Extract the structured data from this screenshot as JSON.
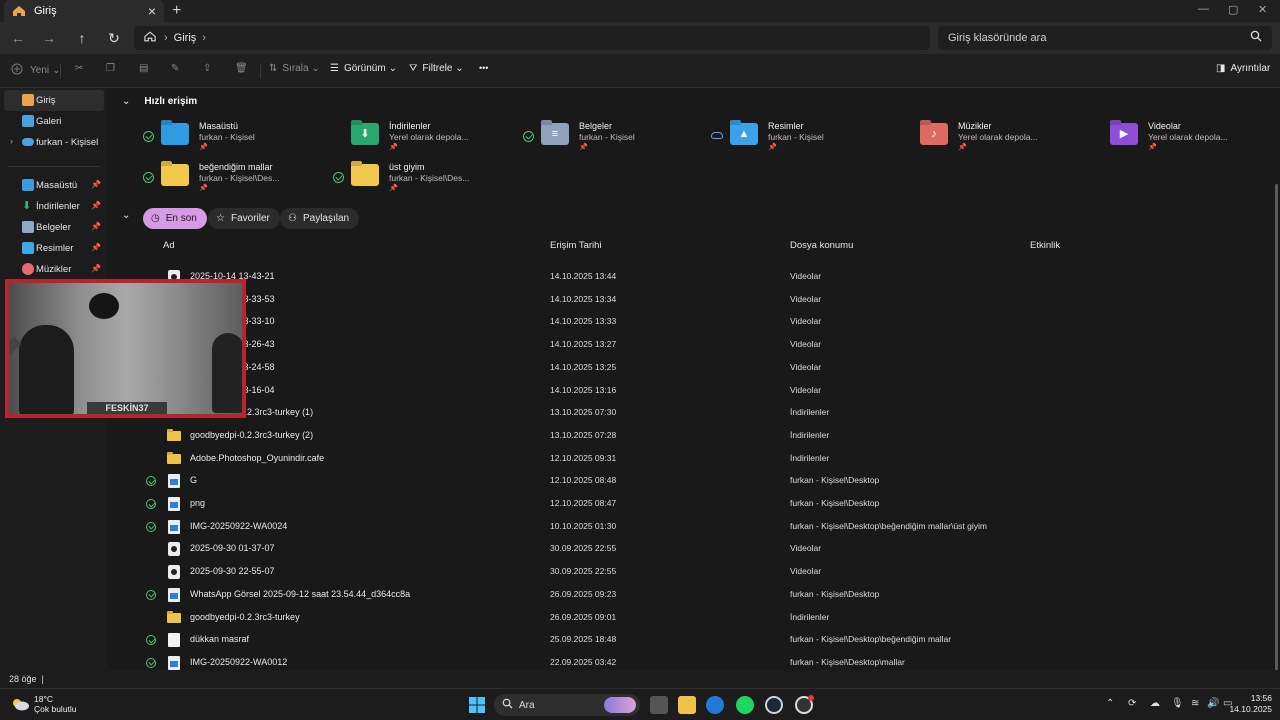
{
  "window": {
    "tab_label": "Giriş",
    "tab_close": "×",
    "new_tab": "+",
    "win_minimize": "—",
    "win_restore": "▢",
    "win_close": "✕"
  },
  "address": {
    "home_sep": "›",
    "crumb": "Giriş",
    "crumb_sep": "›",
    "search_placeholder": "Giriş klasöründe ara"
  },
  "commands": {
    "new": "Yeni",
    "sort": "Sırala",
    "view": "Görünüm",
    "filter": "Filtrele",
    "more": "•••",
    "details": "Ayrıntılar"
  },
  "sidebar": {
    "items": [
      {
        "label": "Giriş",
        "icon": "home-icon",
        "color": "#e8a54b"
      },
      {
        "label": "Galeri",
        "icon": "gallery-icon",
        "color": "#4aa3df"
      },
      {
        "label": "furkan - Kişisel",
        "icon": "cloud-icon",
        "color": "#4aa3df"
      },
      {
        "label": "Masaüstü",
        "icon": "desktop-icon",
        "color": "#3b9ae1"
      },
      {
        "label": "İndirilenler",
        "icon": "download-icon",
        "color": "#36b37e"
      },
      {
        "label": "Belgeler",
        "icon": "documents-icon",
        "color": "#8ea6c7"
      },
      {
        "label": "Resimler",
        "icon": "pictures-icon",
        "color": "#3fa8e6"
      },
      {
        "label": "Müzikler",
        "icon": "music-icon",
        "color": "#e56b6f"
      }
    ]
  },
  "quick_access": {
    "title": "Hızlı erişim",
    "items": [
      {
        "name": "Masaüstü",
        "sub": "furkan - Kişisel",
        "status": "check",
        "color": "#2f9be0",
        "icon": "desktop-folder-icon",
        "glyph": ""
      },
      {
        "name": "İndirilenler",
        "sub": "Yerel olarak depola...",
        "status": "",
        "color": "#27a86c",
        "icon": "downloads-folder-icon",
        "glyph": "⬇"
      },
      {
        "name": "Belgeler",
        "sub": "furkan - Kişisel",
        "status": "check",
        "color": "#8ea2bd",
        "icon": "documents-folder-icon",
        "glyph": "≡"
      },
      {
        "name": "Resimler",
        "sub": "furkan - Kişisel",
        "status": "cloud",
        "color": "#3aa2e8",
        "icon": "pictures-folder-icon",
        "glyph": "▲"
      },
      {
        "name": "Müzikler",
        "sub": "Yerel olarak depola...",
        "status": "",
        "color": "#df6a62",
        "icon": "music-folder-icon",
        "glyph": "♪"
      },
      {
        "name": "Videolar",
        "sub": "Yerel olarak depola...",
        "status": "",
        "color": "#8c4fd6",
        "icon": "videos-folder-icon",
        "glyph": "▶"
      },
      {
        "name": "beğendiğim mallar",
        "sub": "furkan - Kişisel\\Des...",
        "status": "check",
        "color": "#f2c94c",
        "icon": "folder-icon",
        "glyph": ""
      },
      {
        "name": "üst giyim",
        "sub": "furkan - Kişisel\\Des...",
        "status": "check",
        "color": "#f2c94c",
        "icon": "folder-icon",
        "glyph": ""
      }
    ]
  },
  "filters": {
    "recent": "En son",
    "favorites": "Favoriler",
    "shared": "Paylaşılan"
  },
  "columns": {
    "name": "Ad",
    "access": "Erişim Tarihi",
    "location": "Dosya konumu",
    "activity": "Etkinlik"
  },
  "files": [
    {
      "name": "2025-10-14 13-43-21",
      "date": "14.10.2025 13:44",
      "loc": "Videolar",
      "type": "video",
      "sync": false
    },
    {
      "name": "2025-10-14 13-33-53",
      "date": "14.10.2025 13:34",
      "loc": "Videolar",
      "type": "video",
      "sync": false
    },
    {
      "name": "2025-10-14 13-33-10",
      "date": "14.10.2025 13:33",
      "loc": "Videolar",
      "type": "video",
      "sync": false
    },
    {
      "name": "2025-10-14 13-26-43",
      "date": "14.10.2025 13:27",
      "loc": "Videolar",
      "type": "video",
      "sync": false
    },
    {
      "name": "2025-10-14 13-24-58",
      "date": "14.10.2025 13:25",
      "loc": "Videolar",
      "type": "video",
      "sync": false
    },
    {
      "name": "2025-10-14 13-16-04",
      "date": "14.10.2025 13:16",
      "loc": "Videolar",
      "type": "video",
      "sync": false
    },
    {
      "name": "goodbyedpi-0.2.3rc3-turkey (1)",
      "date": "13.10.2025 07:30",
      "loc": "İndirilenler",
      "type": "folder",
      "sync": false
    },
    {
      "name": "goodbyedpi-0.2.3rc3-turkey (2)",
      "date": "13.10.2025 07:28",
      "loc": "İndirilenler",
      "type": "folder",
      "sync": false
    },
    {
      "name": "Adobe.Photoshop_Oyunindir.cafe",
      "date": "12.10.2025 09:31",
      "loc": "İndirilenler",
      "type": "folder",
      "sync": false
    },
    {
      "name": "G",
      "date": "12.10.2025 08:48",
      "loc": "furkan - Kişisel\\Desktop",
      "type": "image",
      "sync": true
    },
    {
      "name": "png",
      "date": "12.10.2025 08:47",
      "loc": "furkan - Kişisel\\Desktop",
      "type": "image",
      "sync": true
    },
    {
      "name": "IMG-20250922-WA0024",
      "date": "10.10.2025 01:30",
      "loc": "furkan - Kişisel\\Desktop\\beğendiğim mallar\\üst giyim",
      "type": "image",
      "sync": true
    },
    {
      "name": "2025-09-30 01-37-07",
      "date": "30.09.2025 22:55",
      "loc": "Videolar",
      "type": "video",
      "sync": false
    },
    {
      "name": "2025-09-30 22-55-07",
      "date": "30.09.2025 22:55",
      "loc": "Videolar",
      "type": "video",
      "sync": false
    },
    {
      "name": "WhatsApp Görsel 2025-09-12 saat 23.54.44_d364cc8a",
      "date": "26.09.2025 09:23",
      "loc": "furkan - Kişisel\\Desktop",
      "type": "image",
      "sync": true
    },
    {
      "name": "goodbyedpi-0.2.3rc3-turkey",
      "date": "26.09.2025 09:01",
      "loc": "İndirilenler",
      "type": "folder",
      "sync": false
    },
    {
      "name": "dükkan masraf",
      "date": "25.09.2025 18:48",
      "loc": "furkan - Kişisel\\Desktop\\beğendiğim mallar",
      "type": "doc",
      "sync": true
    },
    {
      "name": "IMG-20250922-WA0012",
      "date": "22.09.2025 03:42",
      "loc": "furkan - Kişisel\\Desktop\\mallar",
      "type": "image",
      "sync": true
    }
  ],
  "status": {
    "count": "28 öğe"
  },
  "webcam": {
    "tag": "FESKİN37"
  },
  "taskbar": {
    "temp": "18°C",
    "weather": "Çok bulutlu",
    "search": "Ara",
    "time": "13:56",
    "date": "14.10.2025"
  }
}
